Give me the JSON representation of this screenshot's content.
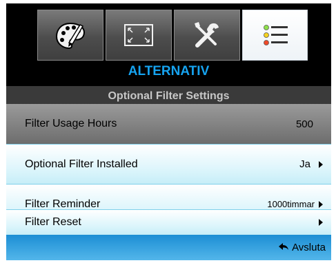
{
  "tabs": [
    {
      "icon": "palette-icon",
      "active": false
    },
    {
      "icon": "screen-resize-icon",
      "active": false
    },
    {
      "icon": "tools-icon",
      "active": false
    },
    {
      "icon": "list-settings-icon",
      "active": true
    }
  ],
  "header": {
    "title": "ALTERNATIV",
    "subtitle": "Optional Filter Settings"
  },
  "rows": [
    {
      "label": "Filter Usage Hours",
      "value": "500"
    },
    {
      "label": "Optional Filter Installed",
      "value": "Ja"
    },
    {
      "label": "Filter Reminder",
      "value": "1000timmar"
    },
    {
      "label": "Filter Reset",
      "value": ""
    }
  ],
  "footer": {
    "exit_label": "Avsluta",
    "icon": "back-arrow-icon"
  },
  "colors": {
    "accent": "#16a3f0",
    "footer": "#1c8ed4",
    "row_bg": "#d9f4fb"
  }
}
